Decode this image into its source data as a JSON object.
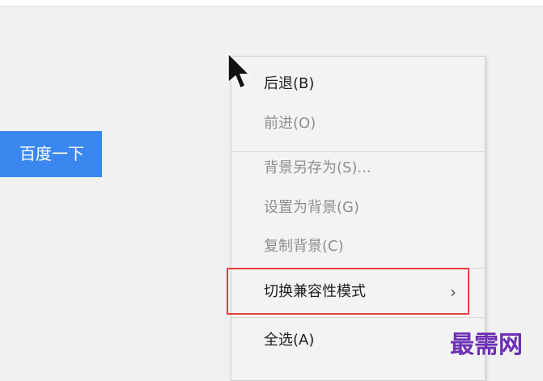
{
  "search_button": {
    "label": "百度一下"
  },
  "context_menu": {
    "items": [
      {
        "label": "后退(B)",
        "enabled": true
      },
      {
        "label": "前进(O)",
        "enabled": false
      },
      {
        "label": "背景另存为(S)...",
        "enabled": false
      },
      {
        "label": "设置为背景(G)",
        "enabled": false
      },
      {
        "label": "复制背景(C)",
        "enabled": false
      },
      {
        "label": "切换兼容性模式",
        "enabled": true,
        "submenu_glyph": "›"
      },
      {
        "label": "全选(A)",
        "enabled": true
      }
    ]
  },
  "watermark": {
    "text": "最需网"
  },
  "colors": {
    "search_button": "#3b87f0",
    "highlight_box": "#e8403e",
    "watermark": "#6c2fb5"
  },
  "icons": {
    "cursor": "mouse-pointer-arrow",
    "submenu": "chevron-right"
  }
}
